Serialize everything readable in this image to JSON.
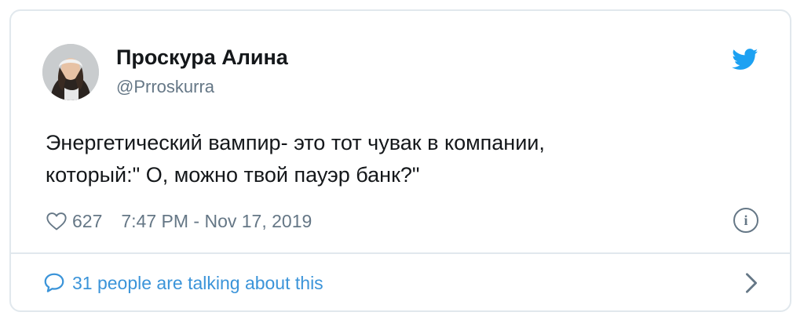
{
  "tweet": {
    "author_name": "Проскура Алина",
    "author_handle": "@Prroskurra",
    "text_line1": "Энергетический вампир- это тот чувак в компании,",
    "text_line2": "который:\" О, можно твой пауэр банк?\"",
    "likes": "627",
    "timestamp": "7:47 PM - Nov 17, 2019",
    "talking_label": "31 people are talking about this"
  },
  "icons": {
    "brand": "twitter-bird-icon",
    "like": "heart-icon",
    "info": "info-icon",
    "reply": "speech-bubble-icon",
    "more": "chevron-right-icon"
  },
  "colors": {
    "brand_blue": "#1da1f2",
    "link_blue": "#3b94d9",
    "secondary_text": "#657786",
    "primary_text": "#14171a",
    "border": "#e1e8ed"
  }
}
